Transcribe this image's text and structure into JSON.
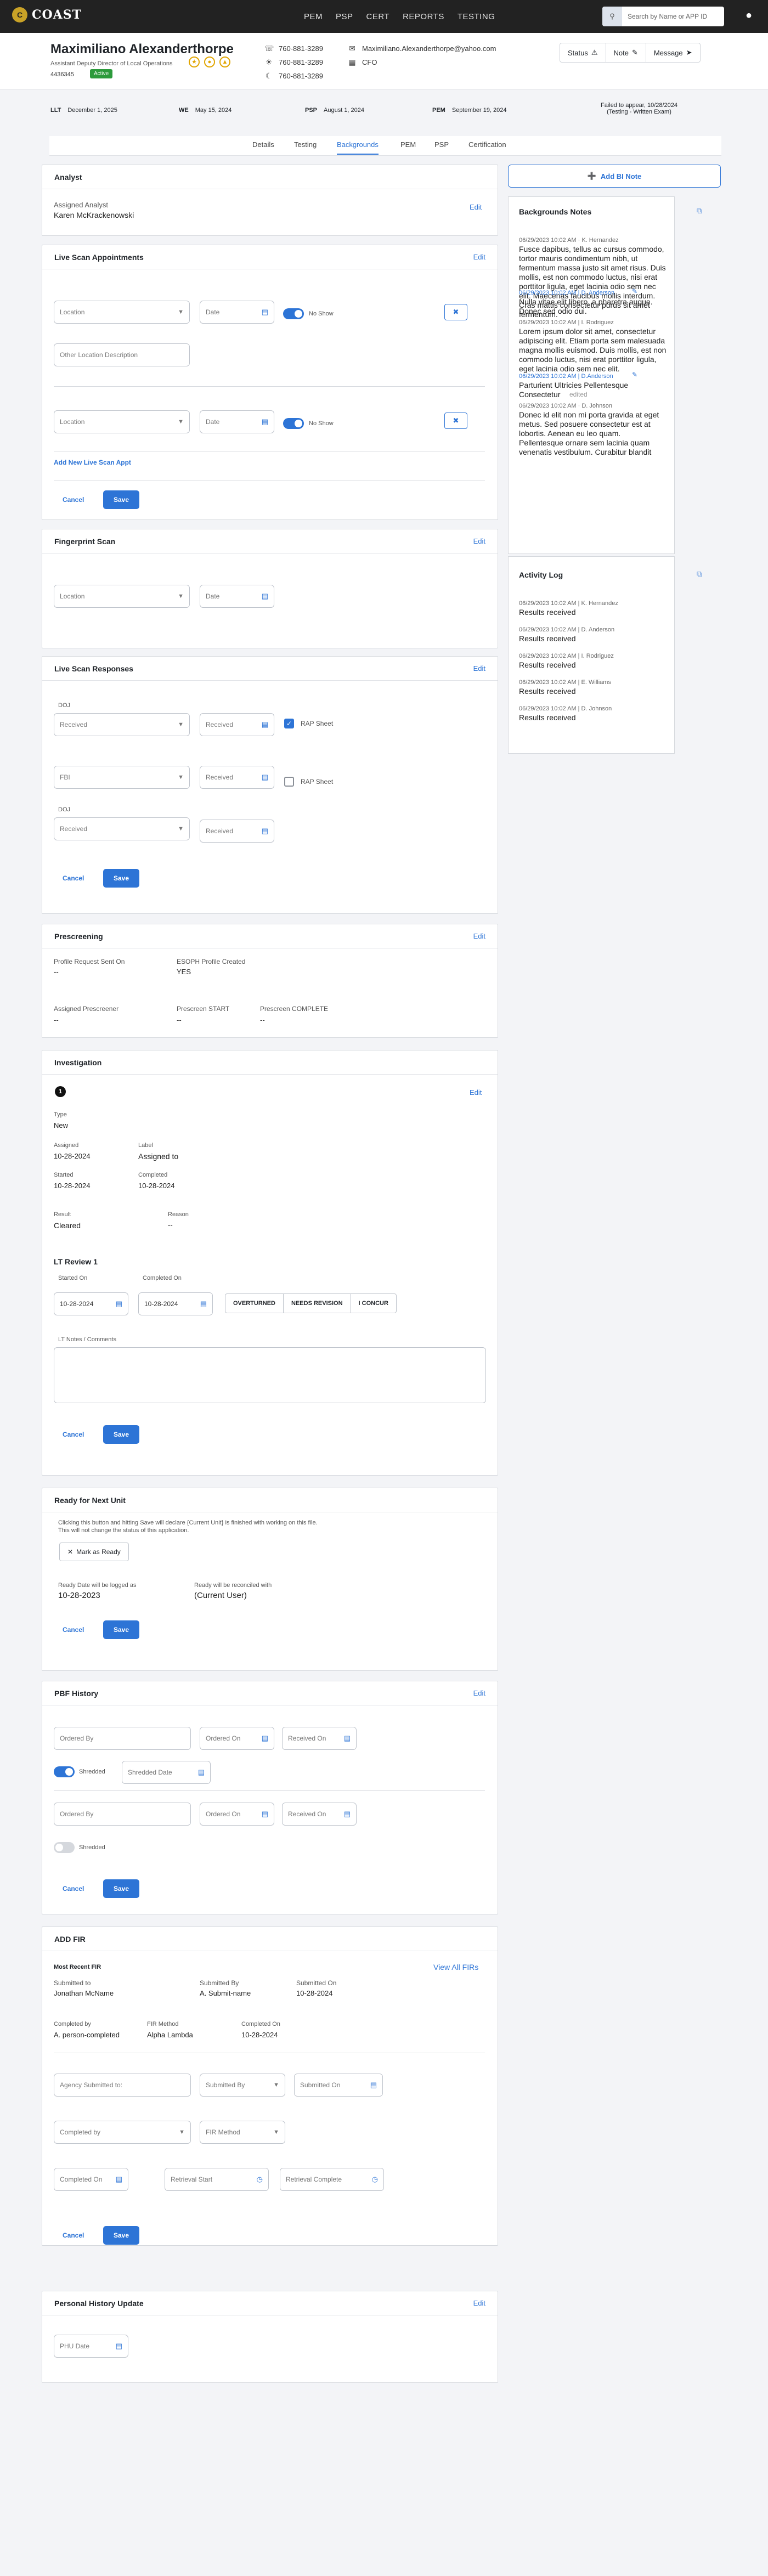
{
  "app": {
    "logo_text": "COAST",
    "logo_mark": "C"
  },
  "nav": [
    "PEM",
    "PSP",
    "CERT",
    "REPORTS",
    "TESTING"
  ],
  "search": {
    "placeholder": "Search by Name or APP ID"
  },
  "profile": {
    "name": "Maximiliano Alexanderthorpe",
    "title": "Assistant Deputy Director of Local Operations",
    "id": "4436345",
    "status": "Active",
    "phones": [
      "760-881-3289",
      "760-881-3289",
      "760-881-3289"
    ],
    "email": "Maximiliano.Alexanderthorpe@yahoo.com",
    "role": "CFO"
  },
  "profile_buttons": {
    "status": "Status",
    "note": "Note",
    "message": "Message"
  },
  "dates": {
    "llt_label": "LLT",
    "llt": "December 1, 2025",
    "we_label": "WE",
    "we": "May 15, 2024",
    "psp_label": "PSP",
    "psp": "August 1, 2024",
    "pem_label": "PEM",
    "pem": "September 19, 2024",
    "appear_line1": "Failed to appear, 10/28/2024",
    "appear_line2": "(Testing - Written Exam)"
  },
  "tabs": [
    "Details",
    "Testing",
    "Backgrounds",
    "PEM",
    "PSP",
    "Certification"
  ],
  "common": {
    "edit": "Edit",
    "cancel": "Cancel",
    "save": "Save",
    "location": "Location",
    "date": "Date",
    "received": "Received"
  },
  "analyst": {
    "title": "Analyst",
    "label": "Assigned Analyst",
    "value": "Karen McKrackenowski"
  },
  "live_scan": {
    "title": "Live Scan Appointments",
    "no_show": "No Show",
    "other_location": "Other Location Description",
    "add_link": "Add New Live Scan Appt"
  },
  "fingerprint": {
    "title": "Fingerprint Scan"
  },
  "responses": {
    "title": "Live Scan Responses",
    "doj": "DOJ",
    "fbi": "FBI",
    "rap": "RAP Sheet"
  },
  "prescreening": {
    "title": "Prescreening",
    "sent_label": "Profile Request Sent On",
    "sent": "--",
    "esoph_label": "ESOPH Profile Created",
    "esoph": "YES",
    "assigned_label": "Assigned Prescreener",
    "assigned": "--",
    "start_label": "Prescreen START",
    "start": "--",
    "complete_label": "Prescreen COMPLETE",
    "complete": "--"
  },
  "investigation": {
    "title": "Investigation",
    "badge": "1",
    "type_label": "Type",
    "type": "New",
    "assigned_label": "Assigned",
    "assigned": "10-28-2024",
    "lbl_label": "Label",
    "lbl": "Assigned to",
    "started_label": "Started",
    "started": "10-28-2024",
    "completed_label": "Completed",
    "completed": "10-28-2024",
    "result_label": "Result",
    "result": "Cleared",
    "reason_label": "Reason",
    "reason": "--",
    "lt_title": "LT Review 1",
    "lt_started_label": "Started On",
    "lt_started": "10-28-2024",
    "lt_completed_label": "Completed On",
    "lt_completed": "10-28-2024",
    "seg": [
      "OVERTURNED",
      "NEEDS REVISION",
      "I CONCUR"
    ],
    "notes_label": "LT Notes / Comments"
  },
  "ready": {
    "title": "Ready for Next Unit",
    "desc1": "Clicking this button and hitting Save will declare {Current Unit} is finished with working on this file.",
    "desc2": "This will not change the status of this application.",
    "button": "Mark as Ready",
    "logged_label": "Ready Date will be logged as",
    "logged": "10-28-2023",
    "reconciled_label": "Ready will be reconciled with",
    "reconciled": "(Current User)"
  },
  "pbf": {
    "title": "PBF History",
    "ordered_by": "Ordered By",
    "ordered_on": "Ordered On",
    "received_on": "Received On",
    "shredded": "Shredded",
    "shredded_date": "Shredded Date"
  },
  "fir": {
    "title": "ADD FIR",
    "most_recent": "Most Recent FIR",
    "view_all": "View All FIRs",
    "submitted_to_label": "Submitted to",
    "submitted_to": "Jonathan McName",
    "submitted_by_label": "Submitted By",
    "submitted_by": "A. Submit-name",
    "submitted_on_label": "Submitted On",
    "submitted_on": "10-28-2024",
    "completed_by_label": "Completed by",
    "completed_by": "A. person-completed",
    "method_label": "FIR Method",
    "method": "Alpha Lambda",
    "completed_on_label": "Completed On",
    "completed_on": "10-28-2024",
    "f_agency": "Agency Submitted to:",
    "f_subby": "Submitted By",
    "f_subon": "Submitted On",
    "f_compby": "Completed by",
    "f_method": "FIR Method",
    "f_compon": "Completed On",
    "f_rstart": "Retrieval Start",
    "f_rcomplete": "Retrieval Complete"
  },
  "phu": {
    "title": "Personal History Update",
    "field": "PHU Date"
  },
  "right": {
    "add_note": "Add BI Note",
    "notes_title": "Backgrounds Notes",
    "notes": [
      {
        "meta": "06/29/2023 10:02 AM  ·  K. Hernandez",
        "text": "Fusce dapibus, tellus ac cursus commodo, tortor mauris condimentum nibh, ut fermentum massa justo sit amet risus. Duis mollis, est non commodo luctus, nisi erat porttitor ligula, eget lacinia odio sem nec elit. Maecenas faucibus mollis interdum. Cras mattis consectetur purus sit amet fermentum."
      },
      {
        "meta": "06/29/2023 10:02 AM  |  D. Anderson",
        "text": "Nulla vitae elit libero, a pharetra augue. Donec sed odio dui."
      },
      {
        "meta": "06/29/2023 10:02 AM  |  I. Rodriguez",
        "text": "Lorem ipsum dolor sit amet, consectetur adipiscing elit. Etiam porta sem malesuada magna mollis euismod. Duis mollis, est non commodo luctus, nisi erat porttitor ligula, eget lacinia odio sem nec elit."
      },
      {
        "meta": "06/29/2023 10:02 AM  |  D.Anderson",
        "text": "Parturient Ultricies Pellentesque Consectetur",
        "edited": "edited"
      },
      {
        "meta": "06/29/2023 10:02 AM  ·  D. Johnson",
        "text": "Donec id elit non mi porta gravida at eget metus. Sed posuere consectetur est at lobortis. Aenean eu leo quam. Pellentesque ornare sem lacinia quam venenatis vestibulum. Curabitur blandit"
      }
    ],
    "activity_title": "Activity Log",
    "activity": [
      {
        "meta": "06/29/2023 10:02 AM  |  K. Hernandez",
        "text": "Results received"
      },
      {
        "meta": "06/29/2023 10:02 AM  |  D. Anderson",
        "text": "Results received"
      },
      {
        "meta": "06/29/2023 10:02 AM  |  I. Rodriguez",
        "text": "Results received"
      },
      {
        "meta": "06/29/2023 10:02 AM  |  E. Williams",
        "text": "Results received"
      },
      {
        "meta": "06/29/2023 10:02 AM  |  D. Johnson",
        "text": "Results received"
      }
    ]
  }
}
